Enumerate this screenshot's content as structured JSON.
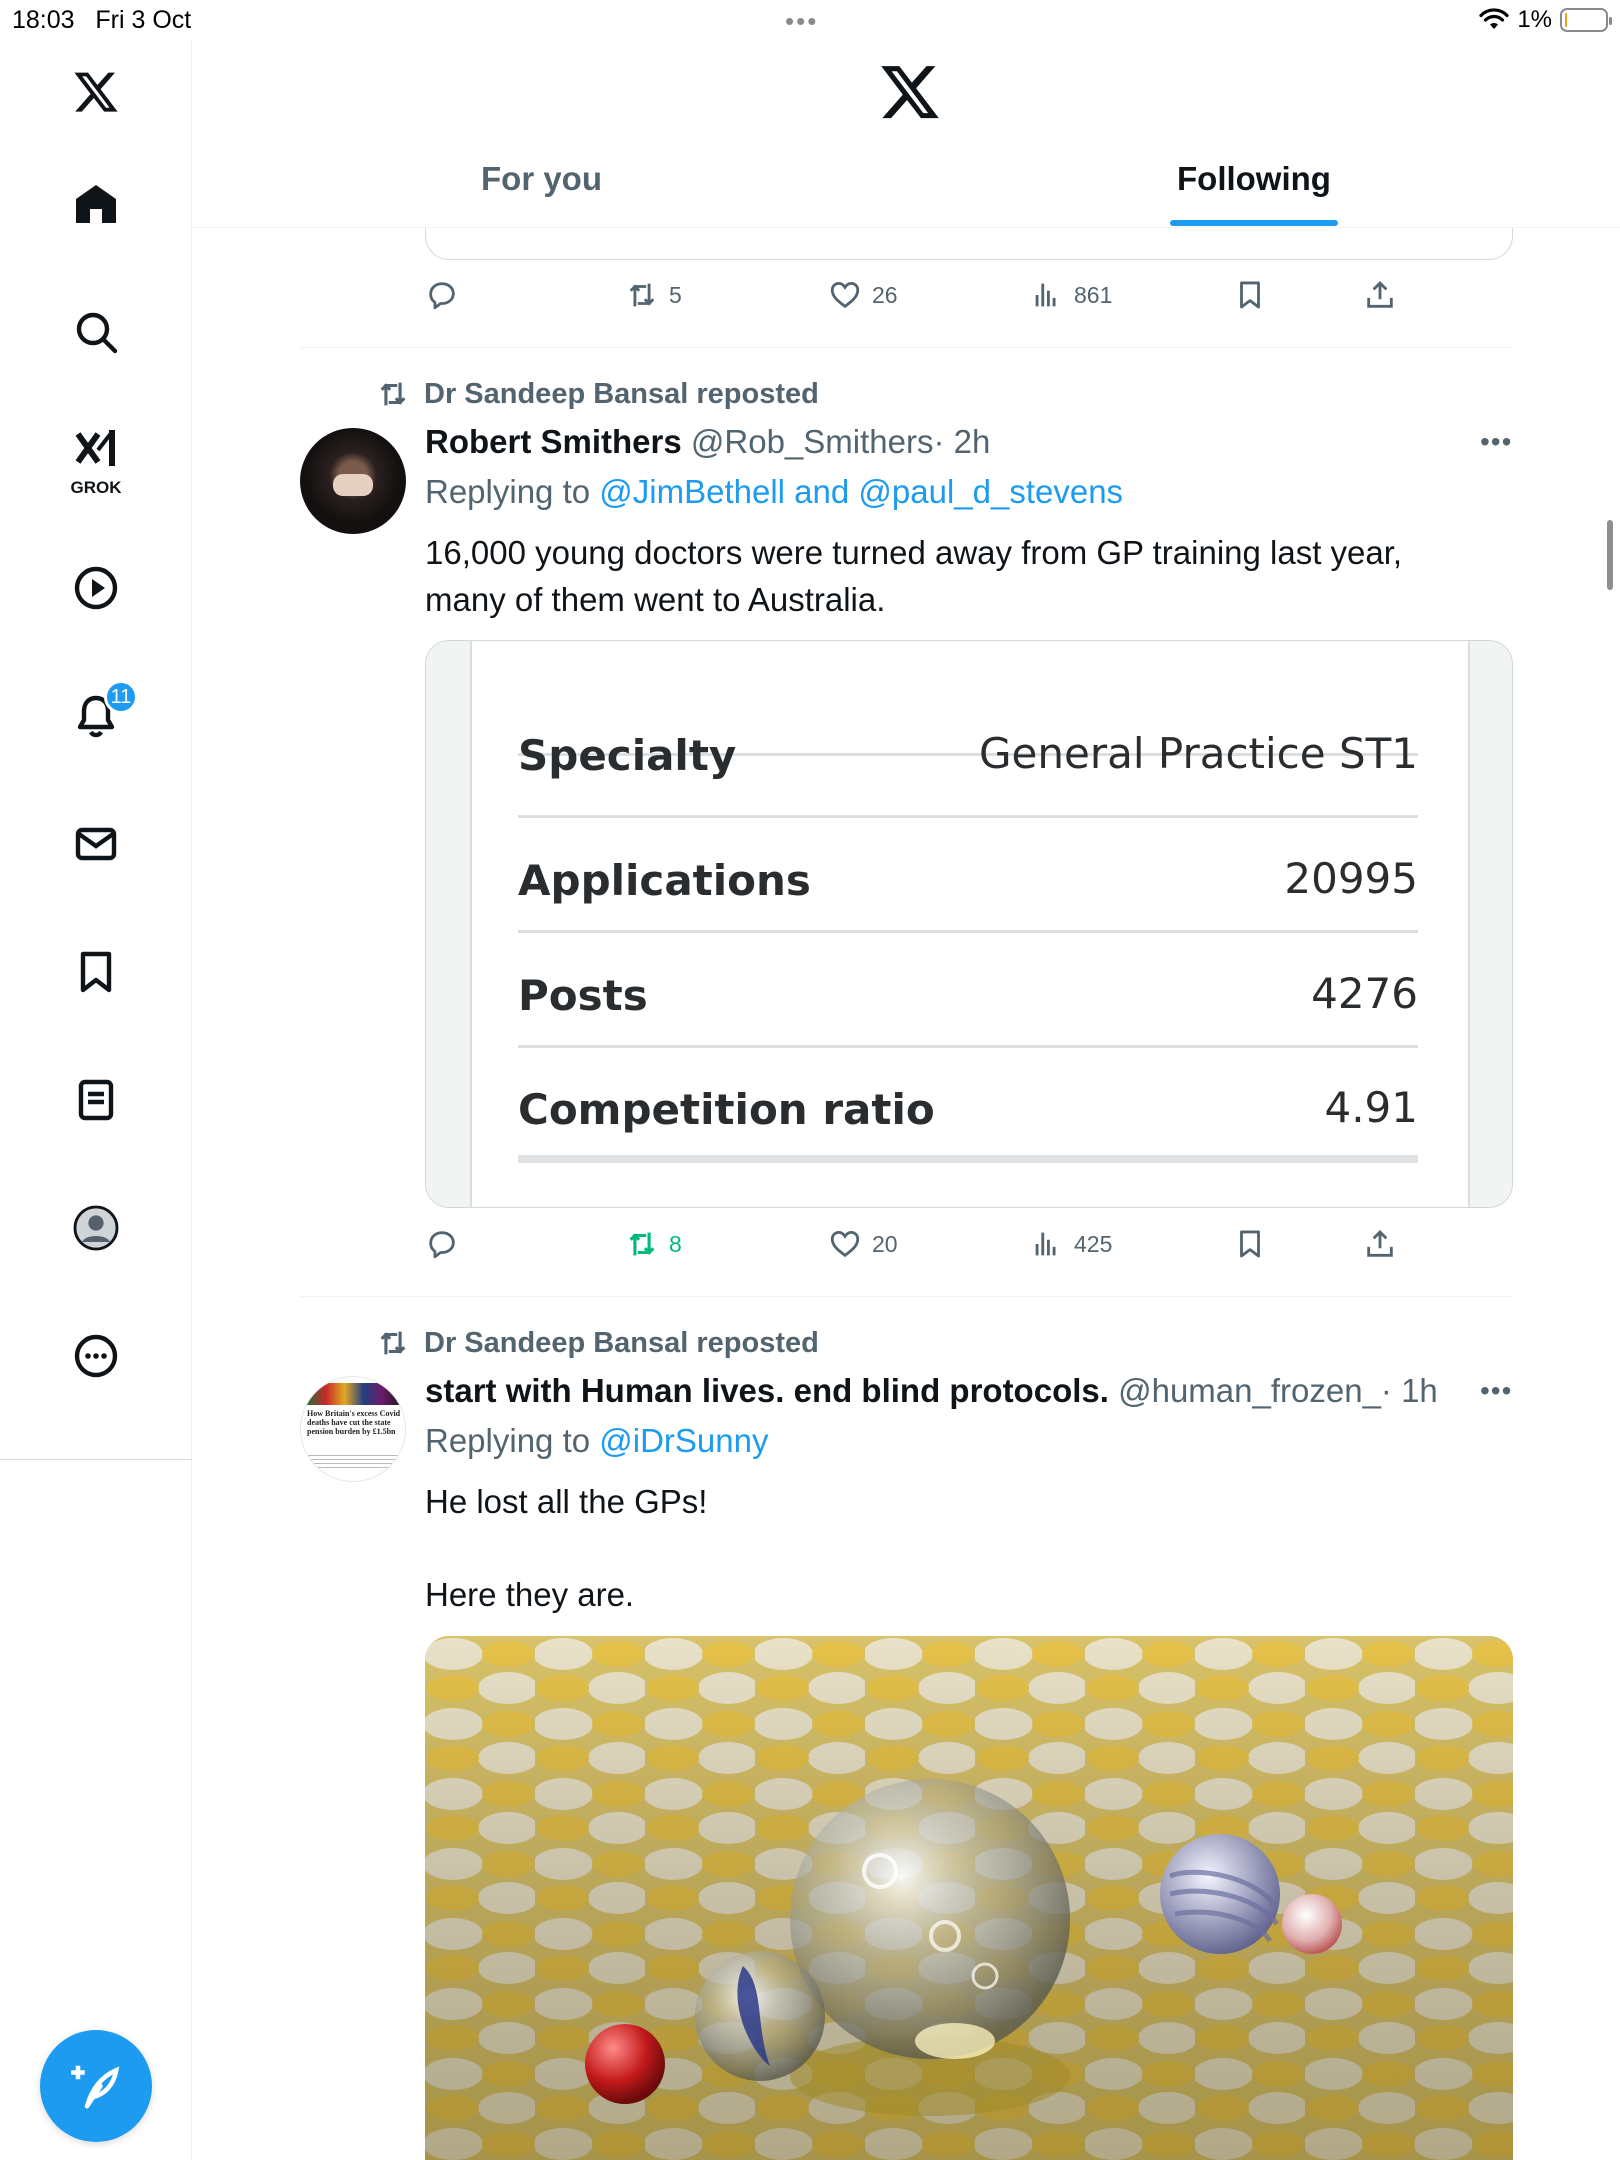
{
  "status_bar": {
    "time": "18:03",
    "date": "Fri 3 Oct",
    "battery": "1%",
    "battery_level": 0.01,
    "dots": "•••"
  },
  "sidebar": {
    "items": [
      {
        "icon": "home-icon"
      },
      {
        "icon": "search-icon"
      },
      {
        "icon": "grok-icon",
        "label": "GROK"
      },
      {
        "icon": "video-icon"
      },
      {
        "icon": "bell-icon",
        "badge": "11"
      },
      {
        "icon": "mail-icon"
      },
      {
        "icon": "bookmark-icon"
      },
      {
        "icon": "lists-icon"
      },
      {
        "icon": "profile-icon"
      },
      {
        "icon": "more-icon"
      }
    ],
    "compose_icon": "compose-feather-icon"
  },
  "header": {
    "tabs": [
      {
        "label": "For you"
      },
      {
        "label": "Following"
      }
    ],
    "active_tab": "Following"
  },
  "feed": {
    "prev_tweet": {
      "actions": {
        "replies": "",
        "reposts": "5",
        "likes": "26",
        "views": "861"
      }
    },
    "tweets": [
      {
        "reposted_by": "Dr Sandeep Bansal reposted",
        "name": "Robert Smithers",
        "handle": "@Rob_Smithers",
        "time": "· 2h",
        "reply_prefix": "Replying to ",
        "reply_to": "@JimBethell and @paul_d_stevens",
        "text": "16,000 young doctors were turned away from GP training last year, many of them went to Australia.",
        "media_table": {
          "rows": [
            {
              "label": "Specialty",
              "value": "General Practice ST1"
            },
            {
              "label": "Applications",
              "value": "20995"
            },
            {
              "label": "Posts",
              "value": "4276"
            },
            {
              "label": "Competition ratio",
              "value": "4.91"
            }
          ]
        },
        "actions": {
          "replies": "",
          "reposts": "8",
          "likes": "20",
          "views": "425"
        }
      },
      {
        "reposted_by": "Dr Sandeep Bansal reposted",
        "name": "start with Human lives. end blind protocols.",
        "handle": "@human_frozen_",
        "time": "· 1h",
        "reply_prefix": "Replying to ",
        "reply_to": "@iDrSunny",
        "text_line1": "He lost all the GPs!",
        "text_line2": "Here they are.",
        "avatar_text": "How Britain's excess Covid deaths have cut the state pension burden by £1.5bn"
      }
    ]
  },
  "colors": {
    "accent": "#1d9bf0",
    "repost_green": "#00ba7c",
    "muted": "#536471"
  }
}
